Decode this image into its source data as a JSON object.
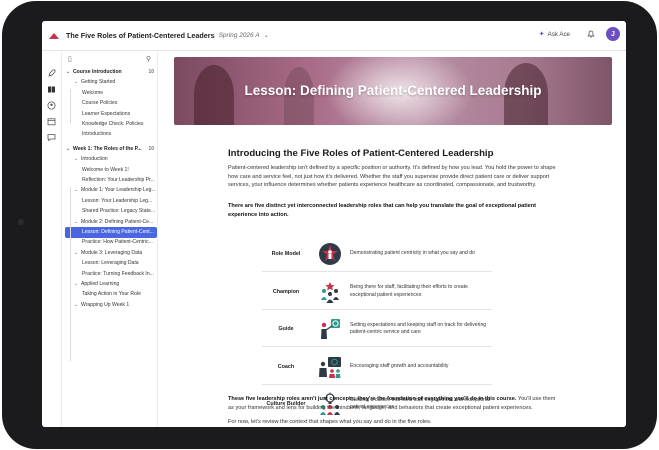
{
  "topbar": {
    "course_title": "The Five Roles of Patient-Centered Leaders",
    "term": "Spring 2026 A",
    "ask_label": "Ask Ace",
    "avatar_initial": "J"
  },
  "sidebar": {
    "items": [
      {
        "label": "Course Introduction",
        "type": "section",
        "count": "10"
      },
      {
        "label": "Getting Started",
        "type": "group"
      },
      {
        "label": "Welcome",
        "type": "page"
      },
      {
        "label": "Course Policies",
        "type": "page"
      },
      {
        "label": "Learner Expectations",
        "type": "page"
      },
      {
        "label": "Knowledge Check: Policies",
        "type": "page"
      },
      {
        "label": "Introductions",
        "type": "page"
      },
      {
        "label": "Week 1: The Roles of the P...",
        "type": "section",
        "count": "10"
      },
      {
        "label": "Introduction",
        "type": "group"
      },
      {
        "label": "Welcome to Week 1!",
        "type": "page"
      },
      {
        "label": "Reflection: Your Leadership Pr...",
        "type": "page"
      },
      {
        "label": "Module 1: Your Leadership Leg...",
        "type": "group"
      },
      {
        "label": "Lesson: Your Leadership Leg...",
        "type": "page"
      },
      {
        "label": "Shared Practice: Legacy State...",
        "type": "page"
      },
      {
        "label": "Module 2: Defining Patient-Ce...",
        "type": "group"
      },
      {
        "label": "Lesson: Defining Patient-Cent...",
        "type": "page",
        "active": true
      },
      {
        "label": "Practice: How Patient-Centric...",
        "type": "page"
      },
      {
        "label": "Module 3: Leveraging Data",
        "type": "group"
      },
      {
        "label": "Lesson: Leveraging Data",
        "type": "page"
      },
      {
        "label": "Practice: Turning Feedback In...",
        "type": "page"
      },
      {
        "label": "Applied Learning",
        "type": "group"
      },
      {
        "label": "Taking Action in Your Role",
        "type": "page"
      },
      {
        "label": "Wrapping Up Week 1",
        "type": "group"
      }
    ]
  },
  "lesson": {
    "banner_title": "Lesson: Defining Patient-Centered Leadership",
    "heading": "Introducing the Five Roles of Patient-Centered Leadership",
    "intro": "Patient-centered leadership isn't defined by a specific position or authority. It's defined by how you lead. You hold the power to shape how care and service feel, not just how it's delivered. Whether the staff you supervise provide direct patient care or deliver support services, your influence determines whether patients experience healthcare as coordinated, compassionate, and trustworthy.",
    "roles_intro": "There are five distinct yet interconnected leadership roles that can help you translate the goal of exceptional patient experience into action.",
    "roles": [
      {
        "name": "Role Model",
        "icon": "role-model-icon",
        "desc": "Demonstrating patient centricity in what you say and do"
      },
      {
        "name": "Champion",
        "icon": "champion-icon",
        "desc": "Being there for staff, facilitating their efforts to create exceptional patient experiences"
      },
      {
        "name": "Guide",
        "icon": "guide-icon",
        "desc": "Setting expectations and keeping staff on track for delivering patient-centric service and care"
      },
      {
        "name": "Coach",
        "icon": "coach-icon",
        "desc": "Encouraging staff growth and accountability"
      },
      {
        "name": "Culture Builder",
        "icon": "culture-builder-icon",
        "desc": "Creating a culture that fuels staff engagement and exceptional patient experiences"
      }
    ],
    "outro_bold": "These five leadership roles aren't just concepts; they're the foundation of everything you'll do in this course.",
    "outro_rest": " You'll use them as your framework and lens for building the mindsets, language, and behaviors that create exceptional patient experiences.",
    "closing": "For now, let's review the context that shapes what you say and do in the five roles."
  },
  "colors": {
    "accent": "#4a67e0",
    "icon_dark": "#2e3a46",
    "icon_red": "#c8324a",
    "icon_teal": "#2f9a8c"
  }
}
